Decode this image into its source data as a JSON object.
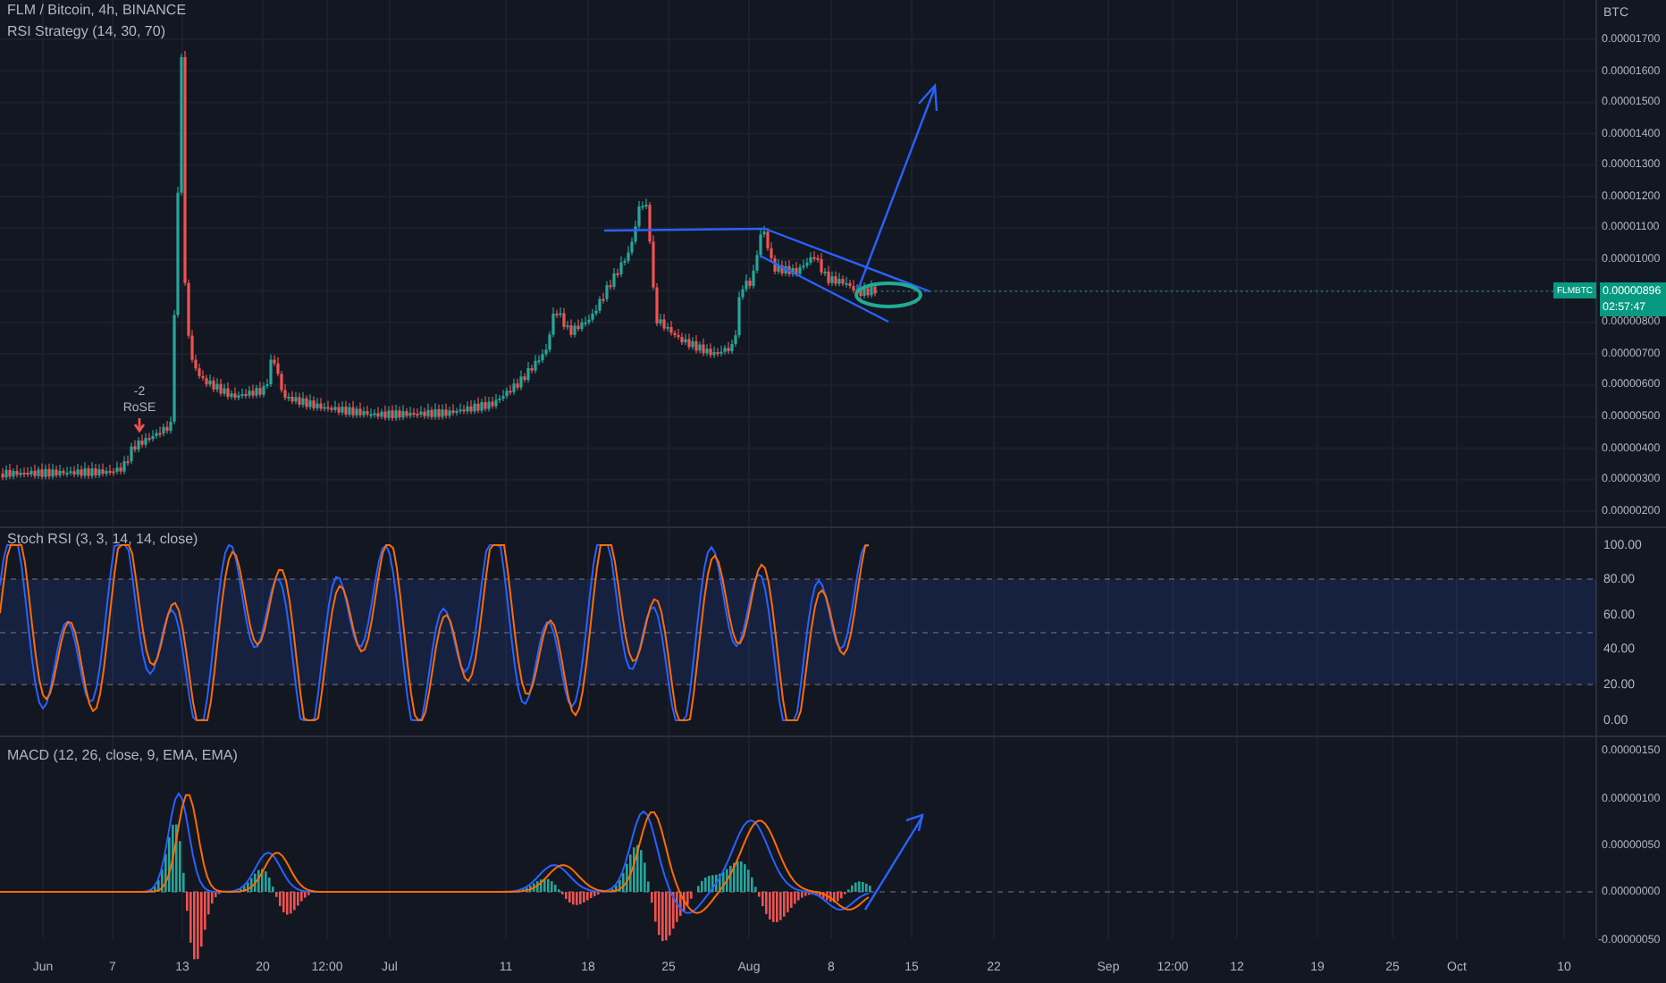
{
  "main_pane": {
    "symbol_legend": "FLM / Bitcoin, 4h, BINANCE",
    "strategy_legend": "RSI Strategy (14, 30, 70)",
    "currency": "BTC",
    "price_axis": [
      "0.00001700",
      "0.00001600",
      "0.00001500",
      "0.00001400",
      "0.00001300",
      "0.00001200",
      "0.00001100",
      "0.00001000",
      "0.00000800",
      "0.00000700",
      "0.00000600",
      "0.00000500",
      "0.00000400",
      "0.00000300",
      "0.00000200"
    ],
    "price_tag": {
      "symbol": "FLMBTC",
      "price": "0.00000896",
      "countdown": "02:57:47"
    },
    "signal_label": {
      "count": "-2",
      "text": "RoSE"
    }
  },
  "stoch_pane": {
    "legend": "Stoch RSI (3, 3, 14, 14, close)",
    "axis": [
      "100.00",
      "80.00",
      "60.00",
      "40.00",
      "20.00",
      "0.00"
    ]
  },
  "macd_pane": {
    "legend": "MACD (12, 26, close, 9, EMA, EMA)",
    "axis": [
      "0.00000150",
      "0.00000100",
      "0.00000050",
      "0.00000000",
      "-0.00000050"
    ]
  },
  "time_axis": [
    "Jun",
    "7",
    "13",
    "20",
    "12:00",
    "Jul",
    "11",
    "18",
    "25",
    "Aug",
    "8",
    "15",
    "22",
    "Sep",
    "12:00",
    "12",
    "19",
    "25",
    "Oct",
    "10"
  ]
}
